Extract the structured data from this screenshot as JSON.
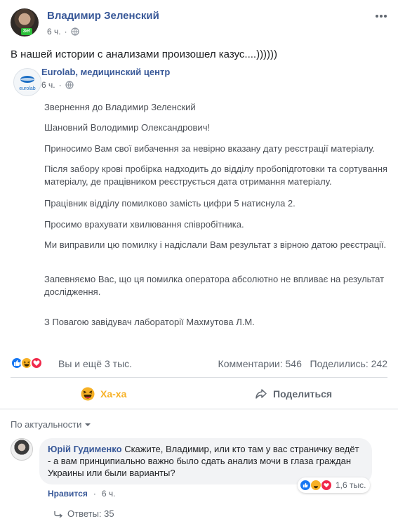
{
  "post": {
    "author": "Владимир Зеленский",
    "time": "6 ч.",
    "text": "В нашей истории с анализами произошел казус....))))))",
    "avatar_badge": "Зе!"
  },
  "shared": {
    "author": "Eurolab, медицинский центр",
    "time": "6 ч.",
    "logo_text": "eurolab",
    "letter": [
      "Звернення до Владимир Зеленский",
      "Шановний Володимир Олександрович!",
      "Приносимо Вам свої вибачення за невірно вказану дату реєстрації матеріалу.",
      "Після забору крові пробірка надходить до відділу пробопідготовки та сортування матеріалу, де працівником реєструється дата отримання матеріалу.",
      "Працівник відділу помилково замість цифри 5 натиснула 2.",
      "Просимо врахувати хвилювання співробітника.",
      "Ми виправили цю помилку і надіслали Вам результат з вірною датою реєстрації.",
      "Запевняємо Вас, що ця помилка оператора абсолютно не впливає на результат дослідження.",
      "З Повагою завідувач лабораторії Махмутова Л.М."
    ]
  },
  "reactions": {
    "summary": "Вы и ещё 3 тыс.",
    "comments": "Комментарии: 546",
    "shares": "Поделились: 242",
    "icons": [
      "like-icon",
      "haha-icon",
      "love-icon"
    ]
  },
  "actions": {
    "haha": "Ха-ха",
    "share": "Поделиться"
  },
  "comments_section": {
    "sort_label": "По актуальности",
    "comment": {
      "author": "Юрій Гудименко",
      "text": "Скажите, Владимир, или кто там у вас страничку ведёт - а вам принципиально важно было сдать анализ мочи в глаза граждан Украины или были варианты?",
      "reaction_count": "1,6 тыс.",
      "like_label": "Нравится",
      "time": "6 ч.",
      "replies": "Ответы: 35"
    }
  },
  "colors": {
    "link": "#385898",
    "secondary": "#616770",
    "like": "#1877f2",
    "haha": "#f7b125",
    "love": "#f0284a"
  }
}
